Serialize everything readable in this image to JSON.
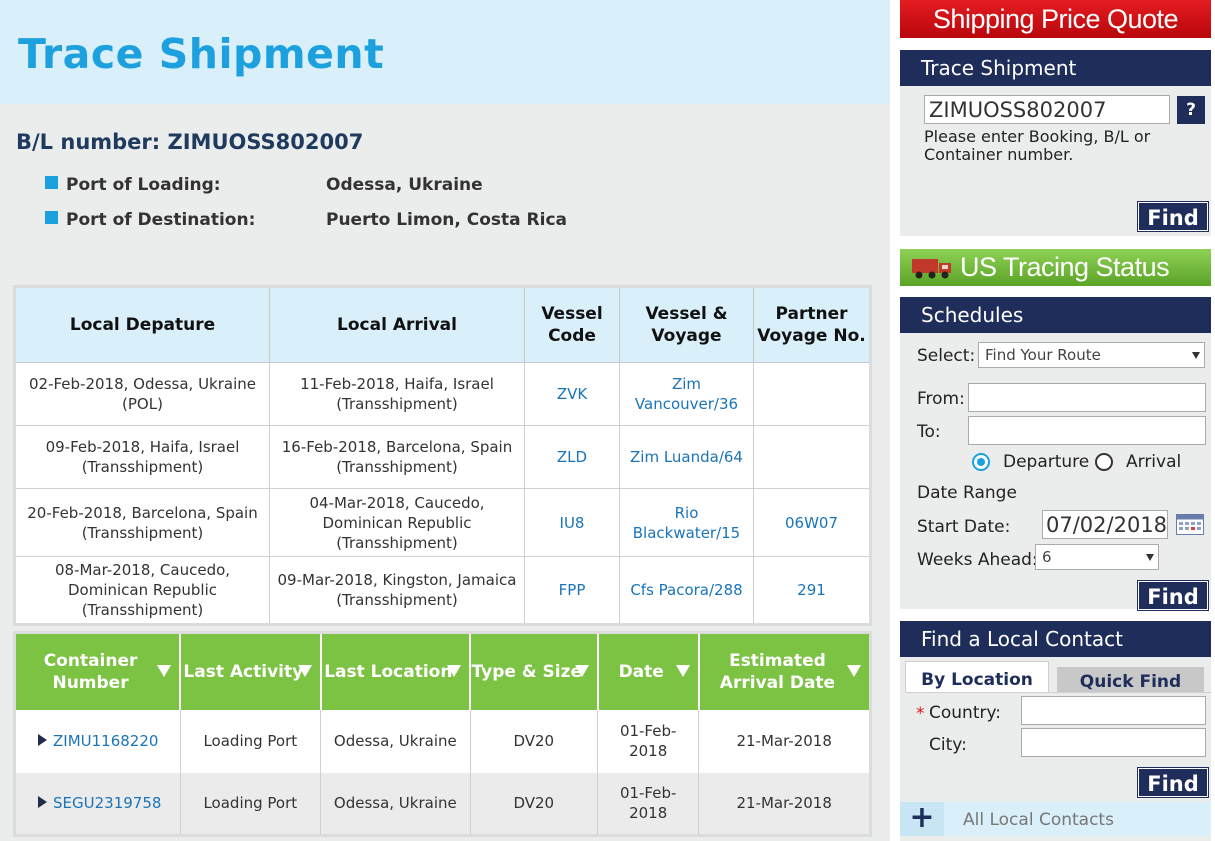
{
  "page": {
    "title": "Trace Shipment",
    "bl_label": "B/L number:",
    "bl_number": "ZIMUOSS802007",
    "ports": [
      {
        "label": "Port of Loading:",
        "value": "Odessa, Ukraine"
      },
      {
        "label": "Port of Destination:",
        "value": "Puerto Limon, Costa Rica"
      }
    ]
  },
  "route_table": {
    "headers": [
      "Local Depature",
      "Local Arrival",
      "Vessel Code",
      "Vessel & Voyage",
      "Partner Voyage No."
    ],
    "rows": [
      {
        "dep": "02-Feb-2018, Odessa, Ukraine (POL)",
        "arr": "11-Feb-2018, Haifa, Israel (Transshipment)",
        "code": "ZVK",
        "voyage": "Zim Vancouver/36",
        "partner": ""
      },
      {
        "dep": "09-Feb-2018, Haifa, Israel (Transshipment)",
        "arr": "16-Feb-2018, Barcelona, Spain (Transshipment)",
        "code": "ZLD",
        "voyage": "Zim Luanda/64",
        "partner": ""
      },
      {
        "dep": "20-Feb-2018, Barcelona, Spain (Transshipment)",
        "arr": "04-Mar-2018, Caucedo, Dominican Republic (Transshipment)",
        "code": "IU8",
        "voyage": "Rio Blackwater/15",
        "partner": "06W07"
      },
      {
        "dep": "08-Mar-2018, Caucedo, Dominican Republic (Transshipment)",
        "arr": "09-Mar-2018, Kingston, Jamaica (Transshipment)",
        "code": "FPP",
        "voyage": "Cfs Pacora/288",
        "partner": "291"
      }
    ]
  },
  "container_table": {
    "headers": [
      "Container Number",
      "Last Activity",
      "Last Location",
      "Type & Size",
      "Date",
      "Estimated Arrival Date"
    ],
    "rows": [
      {
        "number": "ZIMU1168220",
        "activity": "Loading Port",
        "location": "Odessa, Ukraine",
        "type": "DV20",
        "date": "01-Feb-2018",
        "eta": "21-Mar-2018"
      },
      {
        "number": "SEGU2319758",
        "activity": "Loading Port",
        "location": "Odessa, Ukraine",
        "type": "DV20",
        "date": "01-Feb-2018",
        "eta": "21-Mar-2018"
      }
    ]
  },
  "sidebar": {
    "shipping_quote_banner": "Shipping Price Quote",
    "trace": {
      "title": "Trace Shipment",
      "input_value": "ZIMUOSS802007",
      "help": "?",
      "hint": "Please enter Booking, B/L or Container number.",
      "find": "Find"
    },
    "us_tracing_banner": "US Tracing Status",
    "schedules": {
      "title": "Schedules",
      "select_label": "Select:",
      "select_value": "Find Your Route",
      "from_label": "From:",
      "to_label": "To:",
      "radio_departure": "Departure",
      "radio_arrival": "Arrival",
      "date_range": "Date Range",
      "start_label": "Start Date:",
      "start_value": "07/02/2018",
      "weeks_label": "Weeks Ahead:",
      "weeks_value": "6",
      "find": "Find"
    },
    "contact": {
      "title": "Find a Local Contact",
      "tab_location": "By Location",
      "tab_quick": "Quick Find",
      "required_mark": "*",
      "country_label": "Country:",
      "city_label": "City:",
      "find": "Find",
      "all_contacts": "All Local Contacts",
      "plus": "+"
    }
  },
  "colors": {
    "accent_blue": "#1da0de",
    "navy": "#1f2d5a",
    "green": "#7cc243",
    "red": "#d8161b",
    "link": "#1b74b8"
  }
}
